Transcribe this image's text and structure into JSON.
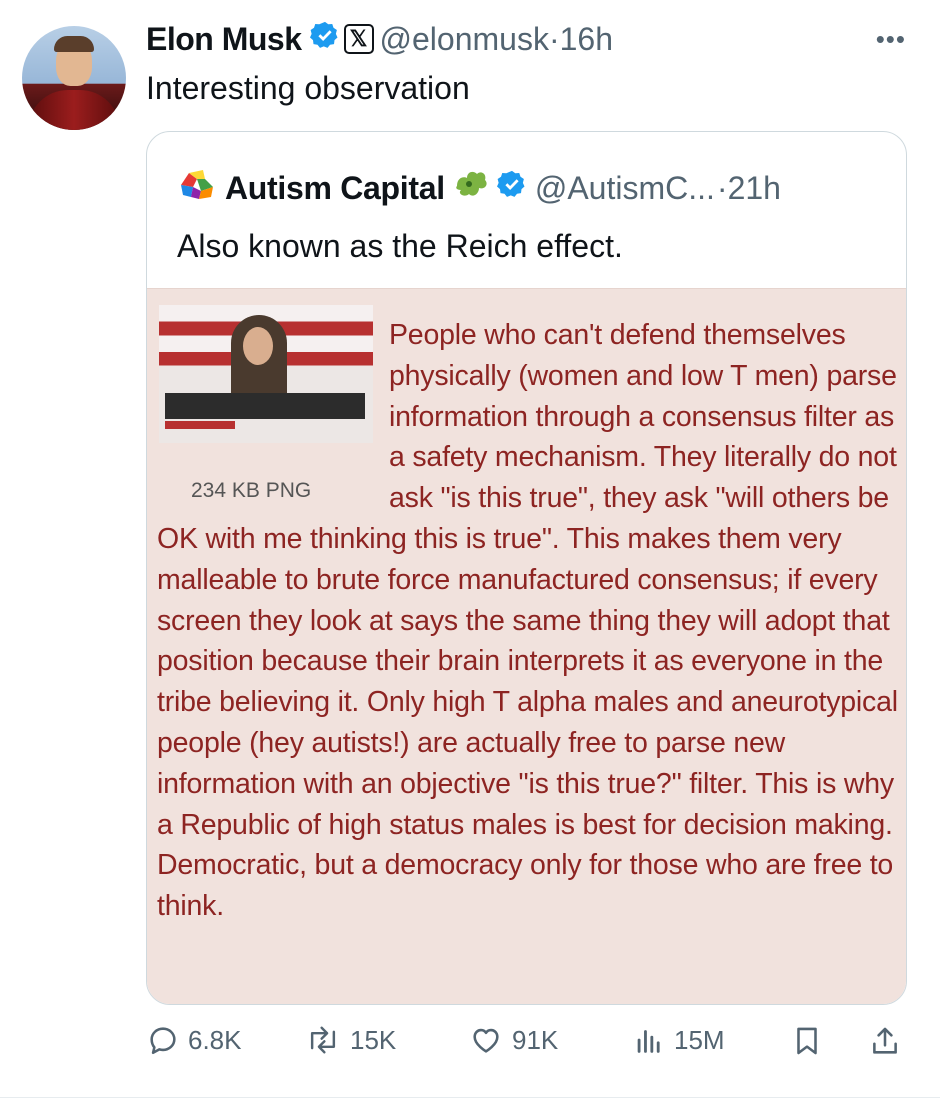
{
  "tweet": {
    "author_name": "Elon Musk",
    "handle": "@elonmusk",
    "separator": "·",
    "time": "16h",
    "text": "Interesting observation"
  },
  "quoted": {
    "author_name": "Autism Capital",
    "handle": "@AutismC...",
    "separator": "·",
    "time": "21h",
    "text": "Also known as the Reich effect.",
    "image_file_size": "234 KB PNG",
    "image_text": "People who can't defend themselves physically (women and low T men) parse information through a consensus filter as a safety mechanism. They literally do not ask \"is this true\", they ask \"will others be OK with me thinking this is true\". This makes them very malleable to brute force manufactured consensus; if every screen they look at says the same thing they will adopt that position because their brain interprets it as everyone in the tribe believing it. Only high T alpha males and aneurotypical people (hey autists!) are actually free to parse new information with an objective \"is this true?\" filter. This is why a Republic of high status males is best for decision making. Democratic, but a democracy only for those who are free to think."
  },
  "actions": {
    "replies": "6.8K",
    "reposts": "15K",
    "likes": "91K",
    "views": "15M"
  },
  "colors": {
    "verified_blue": "#1d9bf0",
    "secondary_text": "#536471",
    "image_text": "#8d2422",
    "image_background": "#f1e2dd"
  },
  "icons": [
    "verified-badge-icon",
    "x-logo-icon",
    "more-icon",
    "puzzle-icon",
    "reply-icon",
    "repost-icon",
    "like-icon",
    "views-icon",
    "bookmark-icon",
    "share-icon"
  ]
}
